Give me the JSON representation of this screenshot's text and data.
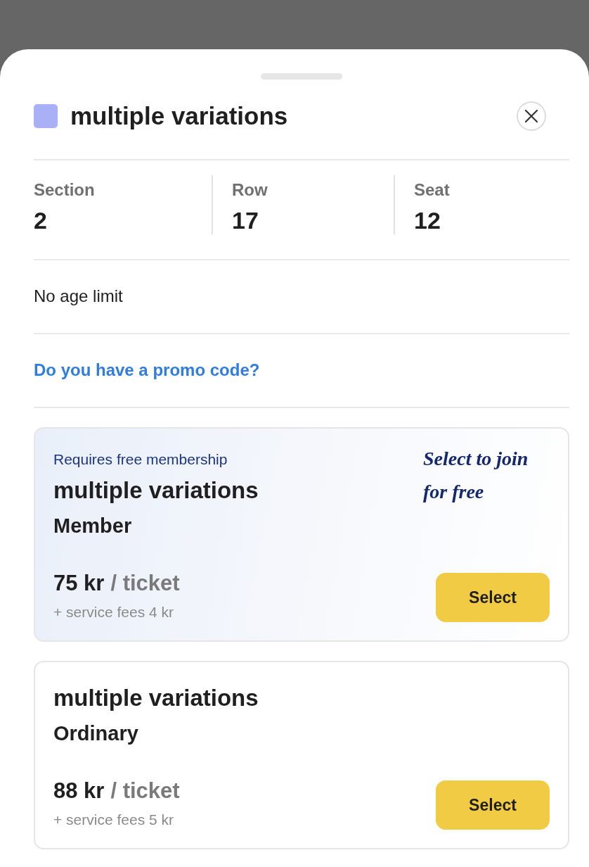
{
  "header": {
    "title": "multiple variations",
    "color": "#aab0f5"
  },
  "seat_info": [
    {
      "label": "Section",
      "value": "2"
    },
    {
      "label": "Row",
      "value": "17"
    },
    {
      "label": "Seat",
      "value": "12"
    }
  ],
  "age_limit": "No age limit",
  "promo_link": "Do you have a promo code?",
  "offers": [
    {
      "kind": "member",
      "note": "Requires free membership",
      "title": "multiple variations",
      "variant": "Member",
      "callout": "Select to join for free",
      "price": "75 kr",
      "unit": "/ ticket",
      "fees": "+ service fees 4 kr",
      "button": "Select"
    },
    {
      "kind": "ordinary",
      "title": "multiple variations",
      "variant": "Ordinary",
      "price": "88 kr",
      "unit": "/ ticket",
      "fees": "+ service fees 5 kr",
      "button": "Select"
    }
  ]
}
